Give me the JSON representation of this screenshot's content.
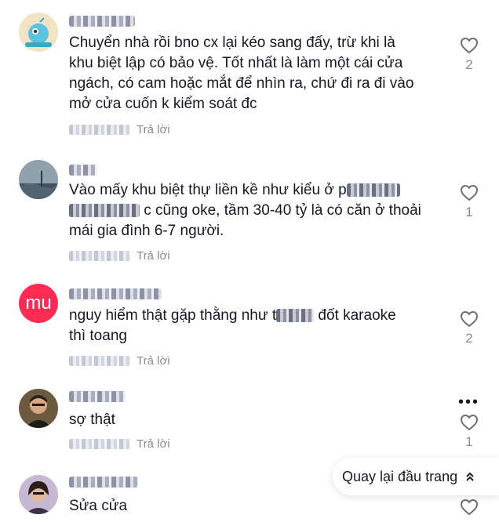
{
  "reply_label": "Trả lời",
  "back_to_top": {
    "label": "Quay lại đầu trang"
  },
  "comments": [
    {
      "text_lines": [
        "Chuyển nhà rồi bno cx lại kéo sang đấy, trừ khi là",
        "khu biệt lập có bảo vệ. Tốt nhất là làm một cái cửa",
        "ngách, có cam hoặc mắt để nhìn ra, chứ đi ra đi vào",
        "mở cửa cuốn k kiểm soát đc"
      ],
      "likes": "2"
    },
    {
      "text_line_1": "Vào mấy khu biệt thự liền kề như kiểu ở p",
      "text_line_2_end": "c cũng oke, tầm 30-40 tỷ là có căn ở thoải",
      "text_line_3": "mái gia đình 6-7 người.",
      "likes": "1"
    },
    {
      "avatar_text": "mu",
      "text_line_1_start": "nguy hiểm thật gặp thằng như t",
      "text_line_1_end": "đốt karaoke",
      "text_line_2": "thì toang",
      "likes": "2"
    },
    {
      "text": "sợ thật",
      "likes": "1"
    },
    {
      "text": "Sửa cửa"
    }
  ],
  "colors": {
    "primary_text": "#161823",
    "secondary_text": "#8a8b91",
    "avatar_mu": "#fe2c55"
  },
  "icons": [
    "heart-outline-icon",
    "more-dots-icon",
    "chevrons-up-icon"
  ]
}
